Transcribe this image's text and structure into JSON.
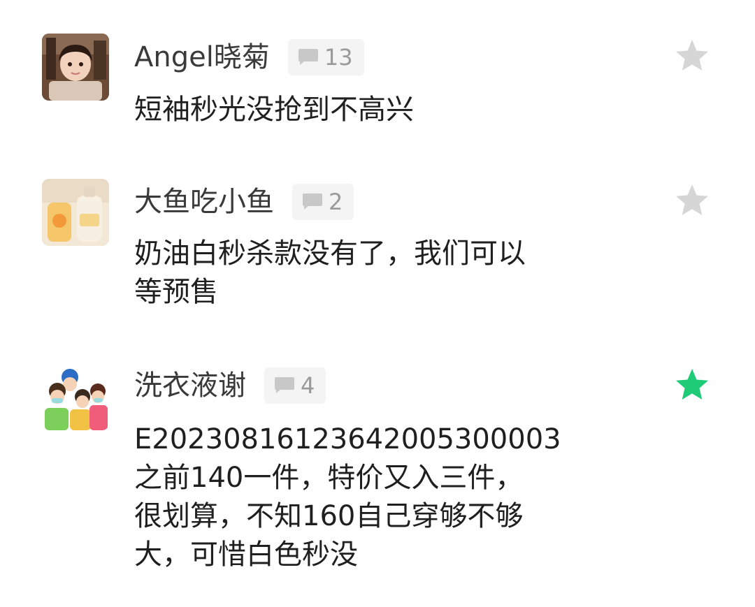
{
  "comments": [
    {
      "author": "Angel晓菊",
      "avatar_icon": "girl-photo-avatar",
      "reply_icon": "comment-bubble-icon",
      "reply_count": "13",
      "text_lines": [
        "短袖秒光没抢到不高兴"
      ],
      "star_icon": "star-icon",
      "starred": false
    },
    {
      "author": "大鱼吃小鱼",
      "avatar_icon": "product-photo-avatar",
      "reply_icon": "comment-bubble-icon",
      "reply_count": "2",
      "text_lines": [
        "奶油白秒杀款没有了，我们可以",
        "等预售"
      ],
      "star_icon": "star-icon",
      "starred": false
    },
    {
      "author": "洗衣液谢",
      "avatar_icon": "family-cartoon-avatar",
      "reply_icon": "comment-bubble-icon",
      "reply_count": "4",
      "text_lines": [
        "E20230816123642005300003",
        "之前140一件，特价又入三件，",
        "很划算，不知160自己穿够不够",
        "大，可惜白色秒没"
      ],
      "star_icon": "star-icon",
      "starred": true
    }
  ],
  "colors": {
    "star_inactive": "#d6d6d6",
    "star_active": "#1fcb77",
    "badge_bg": "#f4f4f4",
    "badge_text": "#9a9a9a"
  }
}
